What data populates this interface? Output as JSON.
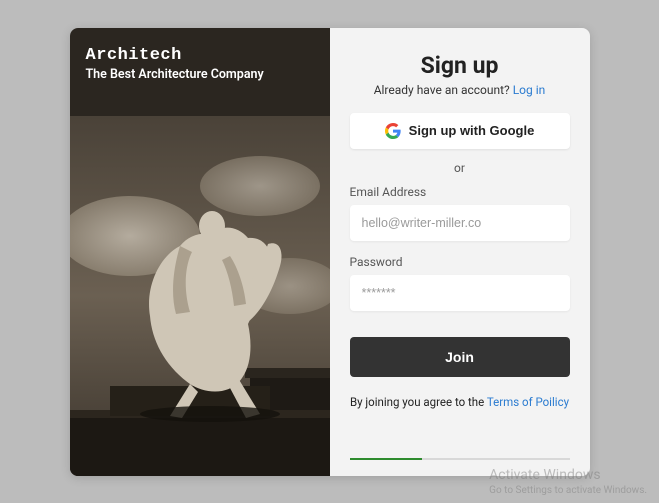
{
  "brand": {
    "title": "Architech",
    "tagline": "The Best Architecture Company"
  },
  "signup": {
    "title": "Sign up",
    "have_account_text": "Already have an account? ",
    "login_link": "Log in",
    "google_label": "Sign up with Google",
    "divider": "or",
    "email_label": "Email Address",
    "email_placeholder": "hello@writer-miller.co",
    "password_label": "Password",
    "password_placeholder": "*******",
    "join_label": "Join",
    "terms_prefix": "By joining you agree to the ",
    "terms_link": "Terms of Poilicy"
  },
  "watermark": {
    "line1": "Activate Windows",
    "line2": "Go to Settings to activate Windows."
  }
}
